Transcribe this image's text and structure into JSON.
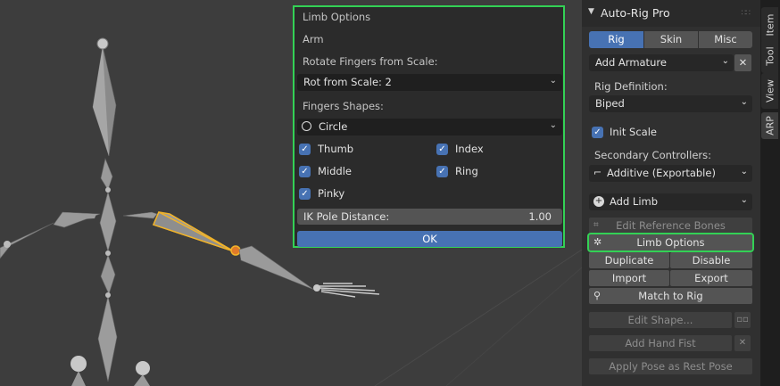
{
  "popup": {
    "title": "Limb Options",
    "limb_type": "Arm",
    "rotate_label": "Rotate Fingers from Scale:",
    "rotate_value": "Rot from Scale: 2",
    "shapes_label": "Fingers Shapes:",
    "shape_value": "Circle",
    "fingers": {
      "thumb": "Thumb",
      "index": "Index",
      "middle": "Middle",
      "ring": "Ring",
      "pinky": "Pinky"
    },
    "ik_label": "IK Pole Distance:",
    "ik_value": "1.00",
    "ok_label": "OK"
  },
  "panel": {
    "title": "Auto-Rig Pro",
    "tabs": [
      "Rig",
      "Skin",
      "Misc"
    ],
    "add_armature": "Add Armature",
    "rig_def_label": "Rig Definition:",
    "rig_def_value": "Biped",
    "init_scale": "Init Scale",
    "secondary_label": "Secondary Controllers:",
    "secondary_value": "Additive (Exportable)",
    "add_limb": "Add Limb",
    "edit_ref": "Edit Reference Bones",
    "limb_options": "Limb Options",
    "duplicate": "Duplicate",
    "disable": "Disable",
    "import": "Import",
    "export": "Export",
    "match_to_rig": "Match to Rig",
    "edit_shape": "Edit Shape...",
    "add_hand_fist": "Add Hand Fist",
    "apply_pose": "Apply Pose as Rest Pose"
  },
  "side_tabs": [
    "Item",
    "Tool",
    "View",
    "ARP"
  ],
  "colors": {
    "accent": "#4772b3",
    "highlight": "#33d155",
    "selection": "#f0b32a"
  }
}
